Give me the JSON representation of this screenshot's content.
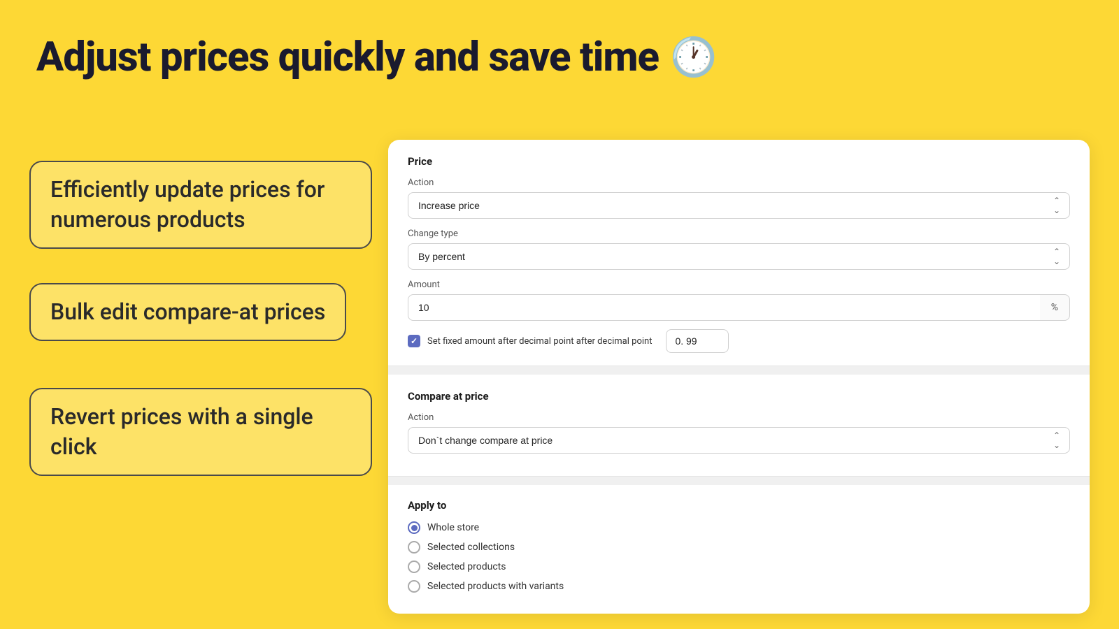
{
  "header": {
    "title": "Adjust prices quickly and save time",
    "clock_emoji": "🕐"
  },
  "features": [
    {
      "id": "feature-1",
      "text": "Efficiently update prices for numerous products"
    },
    {
      "id": "feature-2",
      "text": "Bulk edit compare-at prices"
    },
    {
      "id": "feature-3",
      "text": "Revert prices with a single click"
    }
  ],
  "panel": {
    "price_section": {
      "title": "Price",
      "action_label": "Action",
      "action_value": "Increase price",
      "change_type_label": "Change type",
      "change_type_value": "By percent",
      "amount_label": "Amount",
      "amount_value": "10",
      "amount_suffix": "%",
      "checkbox_label": "Set fixed amount after decimal point after decimal point",
      "decimal_value": "0. 99"
    },
    "compare_section": {
      "title": "Compare at price",
      "action_label": "Action",
      "action_value": "Don`t change compare at price"
    },
    "apply_section": {
      "title": "Apply to",
      "options": [
        {
          "label": "Whole store",
          "selected": true
        },
        {
          "label": "Selected collections",
          "selected": false
        },
        {
          "label": "Selected products",
          "selected": false
        },
        {
          "label": "Selected products with variants",
          "selected": false
        }
      ]
    }
  }
}
